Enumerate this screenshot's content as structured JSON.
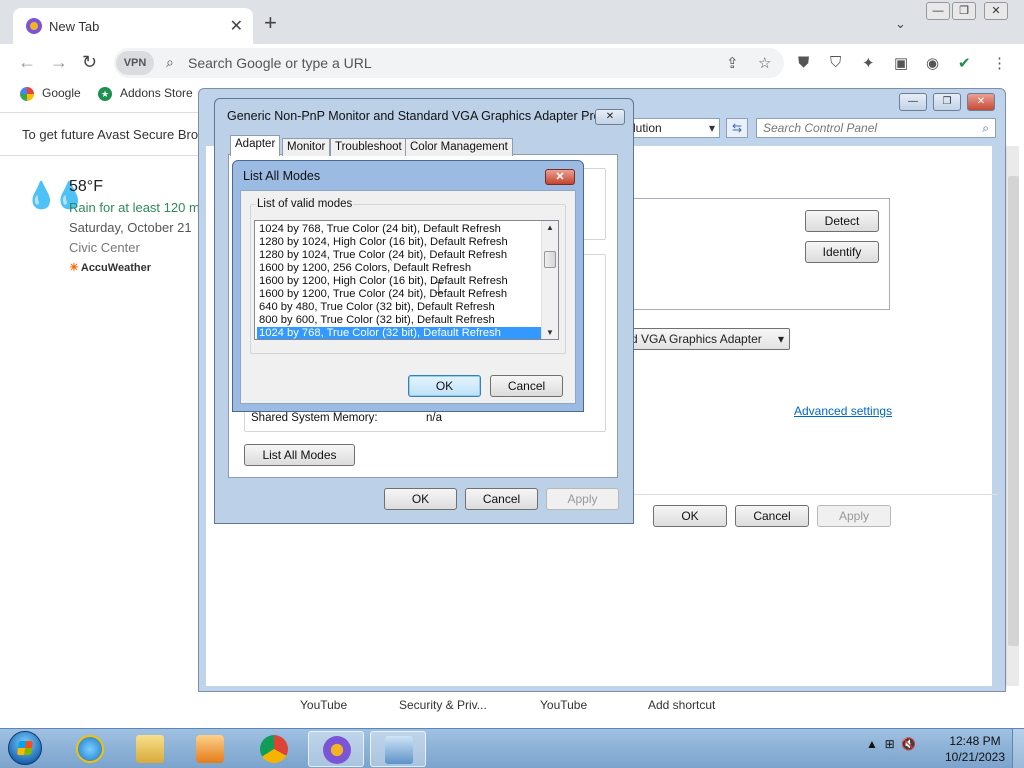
{
  "browser": {
    "tab_title": "New Tab",
    "vpn_label": "VPN",
    "omnibox_placeholder": "Search Google or type a URL",
    "bookmarks": [
      "Google",
      "Addons Store"
    ],
    "notice_text": "To get future Avast Secure Brow",
    "shortcuts": [
      "YouTube",
      "Security & Priv...",
      "YouTube",
      "Add shortcut"
    ]
  },
  "weather": {
    "temperature": "58°F",
    "forecast": "Rain for at least 120 m",
    "date": "Saturday, October 21",
    "location": "Civic Center",
    "provider": "AccuWeather"
  },
  "control_panel": {
    "address_fragment": "lution",
    "search_placeholder": "Search Control Panel",
    "detect_label": "Detect",
    "identify_label": "Identify",
    "display_select": "rd VGA Graphics Adapter",
    "advanced_link": "Advanced settings",
    "ok_label": "OK",
    "cancel_label": "Cancel",
    "apply_label": "Apply"
  },
  "properties_dialog": {
    "title": "Generic Non-PnP Monitor and Standard VGA Graphics Adapter Pro...",
    "tabs": [
      "Adapter",
      "Monitor",
      "Troubleshoot",
      "Color Management"
    ],
    "shared_memory_label": "Shared System Memory:",
    "shared_memory_value": "n/a",
    "list_all_modes_label": "List All Modes",
    "ok_label": "OK",
    "cancel_label": "Cancel",
    "apply_label": "Apply"
  },
  "modes_dialog": {
    "title": "List All Modes",
    "group_label": "List of valid modes",
    "modes": [
      "1024 by 768, True Color (24 bit), Default Refresh",
      "1280 by 1024, High Color (16 bit), Default Refresh",
      "1280 by 1024, True Color (24 bit), Default Refresh",
      "1600 by 1200, 256 Colors, Default Refresh",
      "1600 by 1200, High Color (16 bit), Default Refresh",
      "1600 by 1200, True Color (24 bit), Default Refresh",
      "640 by 480, True Color (32 bit), Default Refresh",
      "800 by 600, True Color (32 bit), Default Refresh",
      "1024 by 768, True Color (32 bit), Default Refresh"
    ],
    "selected_index": 8,
    "ok_label": "OK",
    "cancel_label": "Cancel"
  },
  "taskbar": {
    "time": "12:48 PM",
    "date": "10/21/2023",
    "pinned": [
      "internet-explorer",
      "file-explorer",
      "media-player",
      "chrome",
      "avast-browser",
      "control-panel"
    ]
  }
}
